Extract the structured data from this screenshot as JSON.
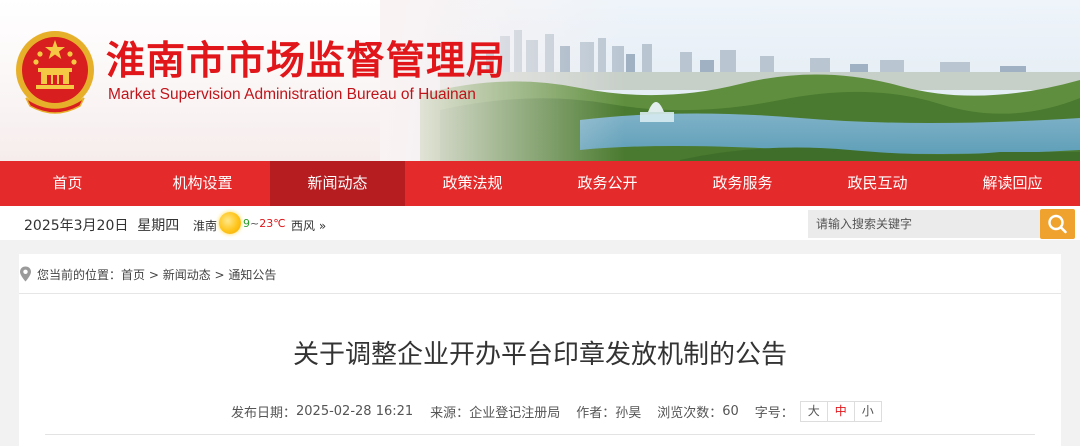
{
  "header": {
    "title": "淮南市市场监督管理局",
    "subtitle": "Market Supervision Administration Bureau of Huainan",
    "emblem_icon": "national-emblem-icon"
  },
  "nav": {
    "items": [
      {
        "label": "首页"
      },
      {
        "label": "机构设置"
      },
      {
        "label": "新闻动态",
        "active": true
      },
      {
        "label": "政策法规"
      },
      {
        "label": "政务公开"
      },
      {
        "label": "政务服务"
      },
      {
        "label": "政民互动"
      },
      {
        "label": "解读回应"
      }
    ],
    "active_color": "#b61d20",
    "bar_color": "#e52a2b"
  },
  "infobar": {
    "date": "2025年3月20日",
    "weekday": "星期四",
    "city": "淮南",
    "weather_icon": "sunny-icon",
    "temp_low": "9",
    "temp_sep": "~",
    "temp_high": "23℃",
    "wind": "西风",
    "wind_more": "»",
    "search_placeholder": "请输入搜索关键字",
    "search_icon": "search-icon",
    "search_button_color": "#f0a22e"
  },
  "breadcrumb": {
    "prefix": "您当前的位置：",
    "items": [
      "首页",
      "新闻动态",
      "通知公告"
    ],
    "separator": " > "
  },
  "article": {
    "title": "关于调整企业开办平台印章发放机制的公告",
    "publish_label": "发布日期：",
    "publish_date": "2025-02-28 16:21",
    "source_label": "来源：",
    "source": "企业登记注册局",
    "author_label": "作者：",
    "author": "孙昊",
    "views_label": "浏览次数：",
    "views": "60",
    "fontsize_label": "字号：",
    "fontsize_options": [
      "大",
      "中",
      "小"
    ],
    "fontsize_selected": "中"
  }
}
